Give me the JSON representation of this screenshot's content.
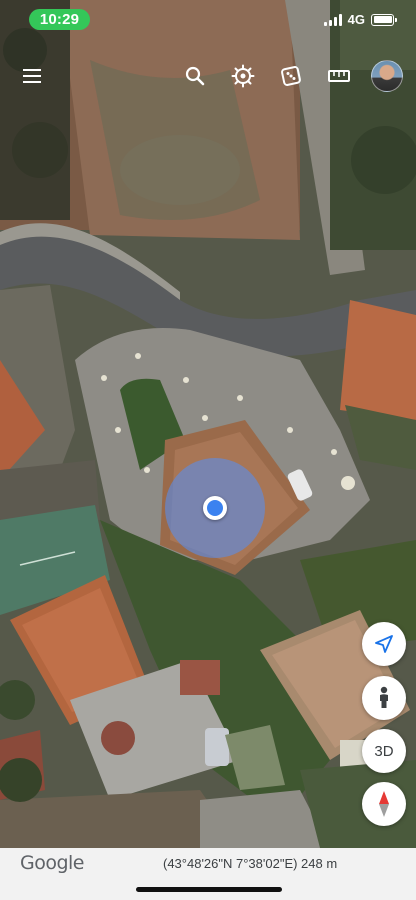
{
  "status_bar": {
    "time": "10:29",
    "network": "4G",
    "time_pill_color": "#34c759"
  },
  "toolbar": {
    "icons": [
      "menu-icon",
      "search-icon",
      "voyager-wheel-icon",
      "dice-icon",
      "ruler-icon"
    ],
    "avatar": "user-avatar"
  },
  "map": {
    "type": "satellite",
    "my_location_color": "#3b82f0"
  },
  "controls": {
    "view_mode_label": "3D",
    "icons": [
      "navigation-arrow-icon",
      "pegman-icon",
      "compass-icon"
    ]
  },
  "footer": {
    "brand": "Google",
    "coordinates": "(43°48'26\"N 7°38'02\"E) 248 m"
  }
}
